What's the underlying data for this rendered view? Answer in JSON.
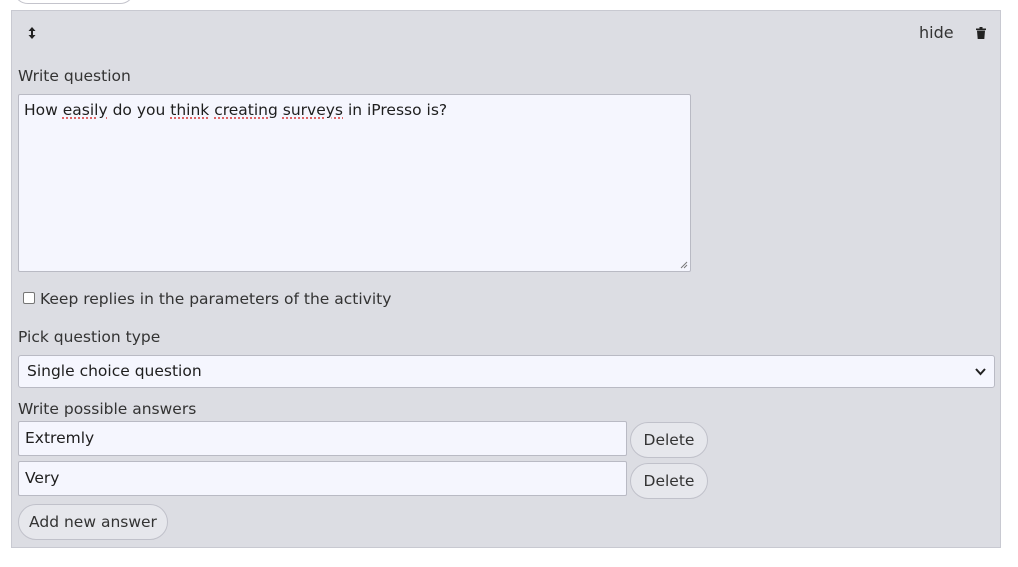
{
  "header": {
    "hide_label": "hide",
    "icons": [
      "drag-handle-icon",
      "trash-icon"
    ]
  },
  "question": {
    "label": "Write question",
    "text_parts": [
      "How ",
      "easily",
      " do you ",
      "think",
      " ",
      "creating",
      " ",
      "surveys",
      " in iPresso is?"
    ]
  },
  "keep_replies": {
    "label": "Keep replies in the parameters of the activity",
    "checked": false
  },
  "question_type": {
    "label": "Pick question type",
    "selected": "Single choice question"
  },
  "answers": {
    "label": "Write possible answers",
    "items": [
      {
        "value": "Extremly",
        "delete_label": "Delete"
      },
      {
        "value": "Very",
        "delete_label": "Delete"
      }
    ],
    "add_label": "Add new answer"
  }
}
